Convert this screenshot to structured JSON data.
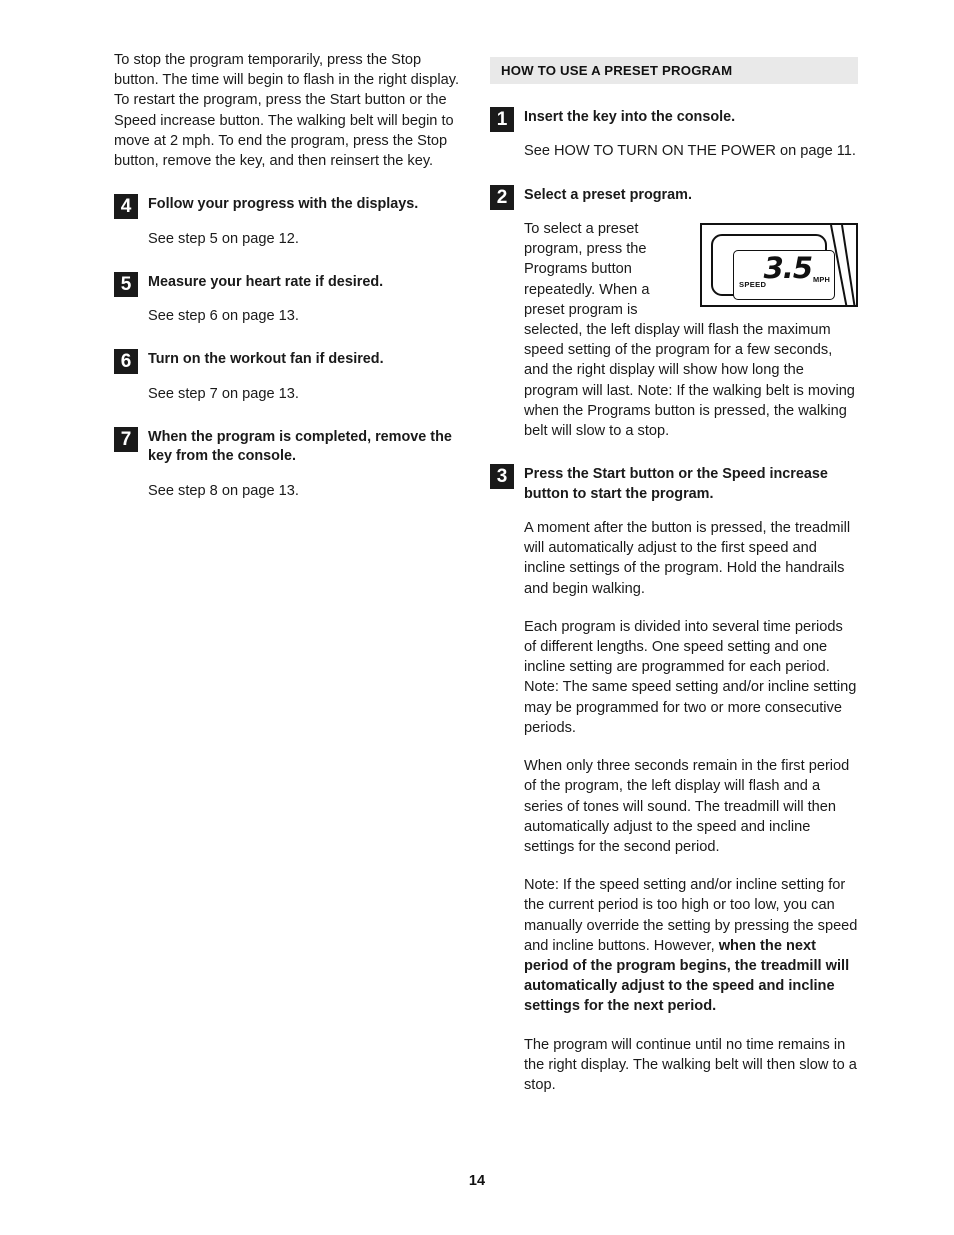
{
  "left_column": {
    "intro_paragraph": "To stop the program temporarily, press the Stop button. The time will begin to flash in the right display. To restart the program, press the Start button or the Speed increase button. The walking belt will begin to move at 2 mph. To end the program, press the Stop button, remove the key, and then reinsert the key.",
    "steps": [
      {
        "number": "4",
        "title": "Follow your progress with the displays.",
        "body": "See step 5 on page 12."
      },
      {
        "number": "5",
        "title": "Measure your heart rate if desired.",
        "body": "See step 6 on page 13."
      },
      {
        "number": "6",
        "title": "Turn on the workout fan if desired.",
        "body": "See step 7 on page 13."
      },
      {
        "number": "7",
        "title": "When the program is completed, remove the key from the console.",
        "body": "See step 8 on page 13."
      }
    ]
  },
  "right_column": {
    "section_header": "HOW TO USE A PRESET PROGRAM",
    "step1": {
      "number": "1",
      "title": "Insert the key into the console.",
      "body": "See HOW TO TURN ON THE POWER on page 11."
    },
    "step2": {
      "number": "2",
      "title": "Select a preset program.",
      "body_wrapped": "To select a preset program, press the Programs button repeatedly. When a preset program is selected, the left display will flash the maximum speed setting of the program for a few seconds, and the right display will show how long the program will last. Note: If the walking belt is moving when the Programs button is pressed, the walking belt will slow to a stop."
    },
    "step3": {
      "number": "3",
      "title": "Press the Start button or the Speed increase button to start the program.",
      "paragraph1": "A moment after the button is pressed, the treadmill will automatically adjust to the first speed and incline settings of the program. Hold the handrails and begin walking.",
      "paragraph2": "Each program is divided into several time periods of different lengths. One speed setting and one incline setting are programmed for each period. Note: The same speed setting and/or incline setting may be programmed for two or more consecutive periods.",
      "paragraph3": "When only three seconds remain in the first period of the program, the left display will flash and a series of tones will sound. The treadmill will then automatically adjust to the speed and incline settings for the second period.",
      "paragraph4_regular": "Note: If the speed setting and/or incline setting for the current period is too high or too low, you can manually override the setting by pressing the speed and incline buttons. However, ",
      "paragraph4_bold": "when the next period of the program begins, the treadmill will automatically adjust to the speed and incline settings for the next period.",
      "paragraph5": "The program will continue until no time remains in the right display. The walking belt will then slow to a stop."
    }
  },
  "console_illustration": {
    "display_value": "3.5",
    "unit_label": "MPH",
    "field_label": "SPEED"
  },
  "footer": {
    "page_number": "14"
  }
}
